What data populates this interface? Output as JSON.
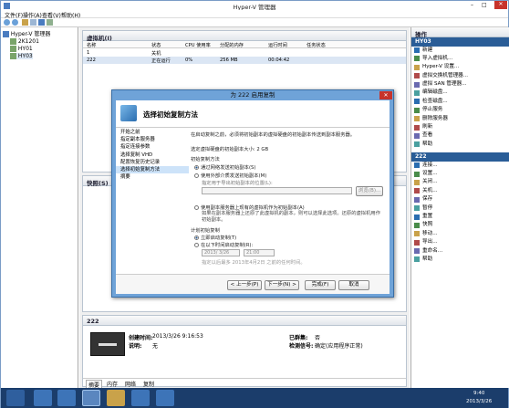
{
  "window": {
    "title": "Hyper-V 管理器"
  },
  "menu": [
    "文件(F)",
    "操作(A)",
    "查看(V)",
    "帮助(H)"
  ],
  "tree": {
    "root": "Hyper-V 管理器",
    "nodes": [
      "2K1201",
      "HY01",
      "HY03"
    ]
  },
  "vm_panel": {
    "title": "虚拟机(I)",
    "columns": [
      "名称",
      "状态",
      "CPU 使用率",
      "分配的内存",
      "运行时间",
      "任务状态"
    ],
    "rows": [
      [
        "1",
        "关机",
        "",
        "",
        "",
        ""
      ],
      [
        "222",
        "正在运行",
        "0%",
        "256 MB",
        "00:04:42",
        ""
      ]
    ]
  },
  "snapshot_panel": {
    "title": "快照(S)"
  },
  "detail": {
    "vm_name": "222",
    "created_label": "创建时间:",
    "created_value": "2013/3/26 9:16:53",
    "notes_label": "说明:",
    "notes_value": "无",
    "cluster_label": "已群集:",
    "cluster_value": "否",
    "heartbeat_label": "检测信号:",
    "heartbeat_value": "确定(应用程序正常)",
    "tabs": [
      "摘要",
      "内存",
      "网络",
      "复制"
    ]
  },
  "actions": {
    "title": "操作",
    "host": "HY03",
    "host_items": [
      "新建",
      "导入虚拟机...",
      "Hyper-V 设置...",
      "虚拟交换机管理器...",
      "虚拟 SAN 管理器...",
      "编辑磁盘...",
      "检查磁盘...",
      "停止服务",
      "删除服务器",
      "刷新",
      "查看",
      "帮助"
    ],
    "vm": "222",
    "vm_items": [
      "连接...",
      "设置...",
      "关闭...",
      "关机...",
      "保存",
      "暂停",
      "重置",
      "快照",
      "移动...",
      "导出...",
      "重命名...",
      "帮助"
    ]
  },
  "dialog": {
    "title": "为 222 启用复制",
    "heading": "选择初始复制方法",
    "nav": [
      "开始之前",
      "指定副本服务器",
      "指定连接参数",
      "选择复制 VHD",
      "配置恢复历史记录",
      "选择初始复制方法",
      "摘要"
    ],
    "nav_selected": 5,
    "intro": "在启动复制之前，必须将初始副本的虚拟硬盘的初始副本传送到副本服务器。",
    "size_line": "选定虚拟硬盘的初始副本大小: 2 GB",
    "method_group": "初始复制方法",
    "opt1": "通过网络发送初始副本(S)",
    "opt2": "使用外部介质发送初始副本(M)",
    "opt2_sub": "指定用于导出初始副本的位置(L):",
    "browse": "浏览(B)...",
    "opt3": "使用副本服务器上现有的虚拟机作为初始副本(A)",
    "opt3_desc": "如果在副本服务器上还原了此虚拟机的副本，则可以选择此选项。还原的虚拟机用作初始副本。",
    "schedule_group": "计划初始复制",
    "sch1": "立即启动复制(T)",
    "sch2": "在以下时间启动复制(R):",
    "date": "2013/ 3/26",
    "time": "21:00",
    "sch_note": "指定以后最多 2013年4月2日 之前的任何时间。",
    "buttons": [
      "< 上一步(P)",
      "下一步(N) >",
      "完成(F)",
      "取消"
    ]
  },
  "taskbar": {
    "time": "9:40",
    "date": "2013/3/26"
  }
}
